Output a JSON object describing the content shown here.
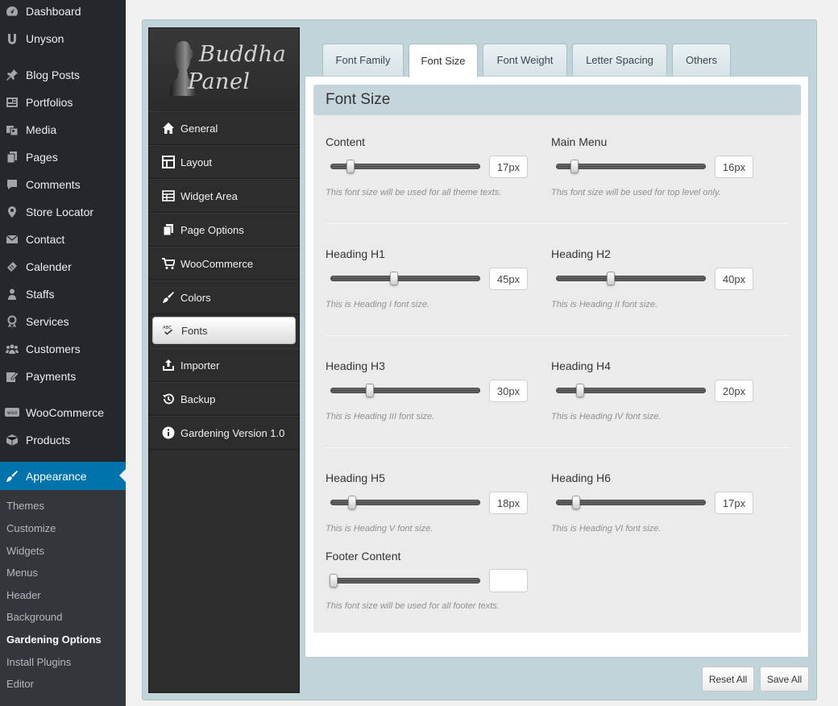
{
  "wp_menu": {
    "items": [
      {
        "label": "Dashboard",
        "icon": "dashboard-icon"
      },
      {
        "label": "Unyson",
        "icon": "unyson-icon"
      },
      {
        "label": "Blog Posts",
        "icon": "pin-icon"
      },
      {
        "label": "Portfolios",
        "icon": "portfolio-icon"
      },
      {
        "label": "Media",
        "icon": "media-icon"
      },
      {
        "label": "Pages",
        "icon": "pages-icon"
      },
      {
        "label": "Comments",
        "icon": "comments-icon"
      },
      {
        "label": "Store Locator",
        "icon": "location-icon"
      },
      {
        "label": "Contact",
        "icon": "envelope-icon"
      },
      {
        "label": "Calender",
        "icon": "calendar-icon"
      },
      {
        "label": "Staffs",
        "icon": "users-icon"
      },
      {
        "label": "Services",
        "icon": "award-icon"
      },
      {
        "label": "Customers",
        "icon": "groups-icon"
      },
      {
        "label": "Payments",
        "icon": "edit-icon"
      },
      {
        "label": "WooCommerce",
        "icon": "woo-icon"
      },
      {
        "label": "Products",
        "icon": "box-icon"
      },
      {
        "label": "Appearance",
        "icon": "brush-icon"
      }
    ],
    "submenu": [
      "Themes",
      "Customize",
      "Widgets",
      "Menus",
      "Header",
      "Background",
      "Gardening Options",
      "Install Plugins",
      "Editor"
    ],
    "submenu_current": "Gardening Options",
    "active_item": "Appearance"
  },
  "logo": {
    "line1": "Buddha",
    "line2": "Panel"
  },
  "panel_nav": [
    {
      "label": "General",
      "icon": "home-icon"
    },
    {
      "label": "Layout",
      "icon": "layout-icon"
    },
    {
      "label": "Widget Area",
      "icon": "widget-grid-icon"
    },
    {
      "label": "Page Options",
      "icon": "copy-pages-icon"
    },
    {
      "label": "WooCommerce",
      "icon": "cart-icon"
    },
    {
      "label": "Colors",
      "icon": "brush-icon"
    },
    {
      "label": "Fonts",
      "icon": "abc-check-icon"
    },
    {
      "label": "Importer",
      "icon": "upload-icon"
    },
    {
      "label": "Backup",
      "icon": "history-icon"
    },
    {
      "label": "Gardening Version 1.0",
      "icon": "info-icon"
    }
  ],
  "panel_nav_active": "Fonts",
  "tabs": [
    "Font Family",
    "Font Size",
    "Font Weight",
    "Letter Spacing",
    "Others"
  ],
  "active_tab": "Font Size",
  "section_title": "Font Size",
  "options": {
    "content": {
      "label": "Content",
      "value": "17px",
      "level": 0.12,
      "desc": "This font size will be used for all theme texts."
    },
    "main_menu": {
      "label": "Main Menu",
      "value": "16px",
      "level": 0.11,
      "desc": "This font size will be used for top level only."
    },
    "h1": {
      "label": "Heading H1",
      "value": "45px",
      "level": 0.43,
      "desc": "This is Heading I font size."
    },
    "h2": {
      "label": "Heading H2",
      "value": "40px",
      "level": 0.37,
      "desc": "This is Heading II font size."
    },
    "h3": {
      "label": "Heading H3",
      "value": "30px",
      "level": 0.26,
      "desc": "This is Heading III font size."
    },
    "h4": {
      "label": "Heading H4",
      "value": "20px",
      "level": 0.15,
      "desc": "This is Heading IV font size."
    },
    "h5": {
      "label": "Heading H5",
      "value": "18px",
      "level": 0.13,
      "desc": "This is Heading V font size."
    },
    "h6": {
      "label": "Heading H6",
      "value": "17px",
      "level": 0.12,
      "desc": "This is Heading VI font size."
    },
    "footer": {
      "label": "Footer Content",
      "value": "",
      "level": 0.0,
      "desc": "This font size will be used for all footer texts."
    }
  },
  "buttons": {
    "reset": "Reset All",
    "save": "Save All"
  },
  "colors": {
    "wp_sidebar": "#23282d",
    "wp_active": "#0073aa",
    "frame": "#c1d4da",
    "panel_nav": "#2d2d2d"
  }
}
